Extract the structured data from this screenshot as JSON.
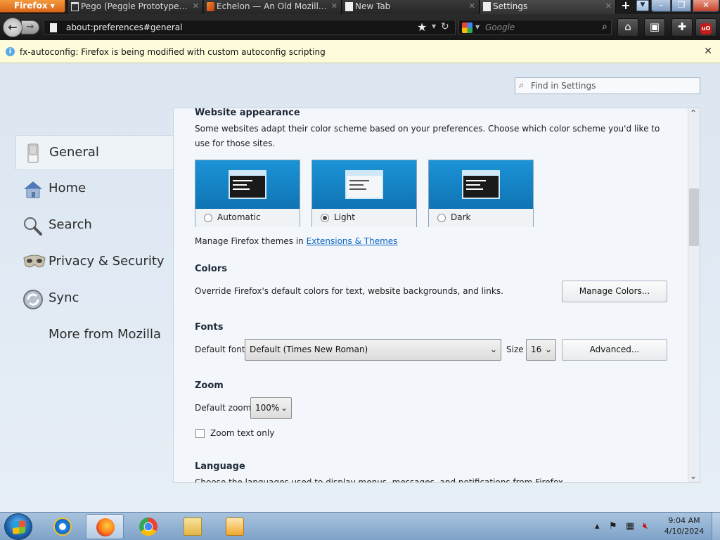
{
  "window": {
    "firefox_button": "Firefox",
    "tabs": [
      {
        "label": "Pego (Peggle Prototype - A..."
      },
      {
        "label": "Echelon — An Old Mozilla ..."
      },
      {
        "label": "New Tab"
      },
      {
        "label": "Settings"
      }
    ],
    "new_tab": "+",
    "minimize": "–",
    "maximize": "❐",
    "close": "✕"
  },
  "navbar": {
    "url": "about:preferences#general",
    "search_placeholder": "Google"
  },
  "notification": {
    "text": "fx-autoconfig: Firefox is being modified with custom autoconfig scripting",
    "close": "✕"
  },
  "find": {
    "placeholder": "Find in Settings"
  },
  "sidebar": {
    "items": [
      {
        "label": "General"
      },
      {
        "label": "Home"
      },
      {
        "label": "Search"
      },
      {
        "label": "Privacy & Security"
      },
      {
        "label": "Sync"
      },
      {
        "label": "More from Mozilla"
      }
    ]
  },
  "website_appearance": {
    "heading": "Website appearance",
    "description": "Some websites adapt their color scheme based on your preferences. Choose which color scheme you'd like to use for those sites.",
    "options": [
      {
        "label": "Automatic",
        "selected": false
      },
      {
        "label": "Light",
        "selected": true
      },
      {
        "label": "Dark",
        "selected": false
      }
    ],
    "manage_prefix": "Manage Firefox themes in",
    "manage_link": "Extensions & Themes"
  },
  "colors": {
    "heading": "Colors",
    "description": "Override Firefox's default colors for text, website backgrounds, and links.",
    "button": "Manage Colors..."
  },
  "fonts": {
    "heading": "Fonts",
    "default_font_label": "Default font",
    "default_font_value": "Default (Times New Roman)",
    "size_label": "Size",
    "size_value": "16",
    "advanced_button": "Advanced..."
  },
  "zoom": {
    "heading": "Zoom",
    "default_zoom_label": "Default zoom",
    "default_zoom_value": "100%",
    "text_only_label": "Zoom text only"
  },
  "language": {
    "heading": "Language",
    "description": "Choose the languages used to display menus, messages, and notifications from Firefox."
  },
  "taskbar": {
    "time": "9:04 AM",
    "date": "4/10/2024"
  },
  "colors_ui": {
    "accent": "#0b66c3",
    "theme_blue": "#1287c9"
  }
}
